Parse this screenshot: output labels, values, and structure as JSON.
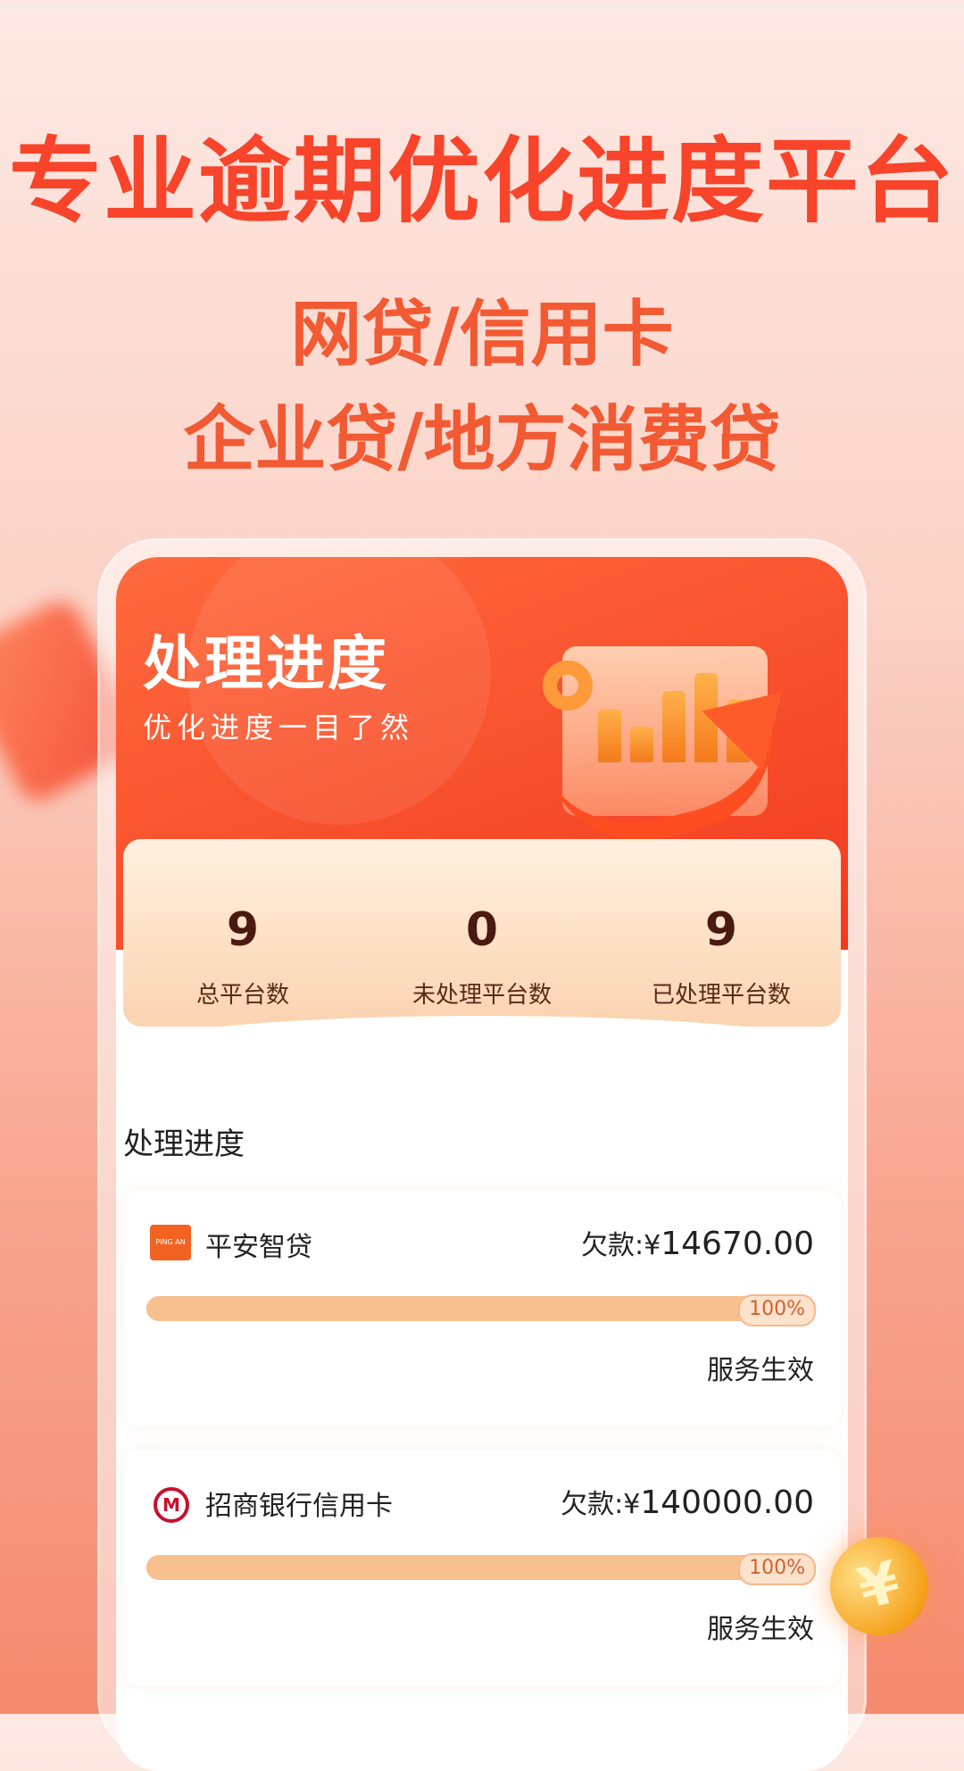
{
  "hero": {
    "title": "专业逾期优化进度平台",
    "subtitle_line1": "网贷/信用卡",
    "subtitle_line2": "企业贷/地方消费贷"
  },
  "screen": {
    "title": "处理进度",
    "subtitle": "优化进度一目了然",
    "stats": [
      {
        "value": "9",
        "label": "总平台数"
      },
      {
        "value": "0",
        "label": "未处理平台数"
      },
      {
        "value": "9",
        "label": "已处理平台数"
      }
    ],
    "section_title": "处理进度",
    "items": [
      {
        "logo": "平安logo",
        "name": "平安智贷",
        "debt_label": "欠款:",
        "currency": "¥",
        "amount": "14670.00",
        "progress": 1.0,
        "progress_text": "100%",
        "status": "服务生效"
      },
      {
        "logo": "招商银行logo",
        "name": "招商银行信用卡",
        "debt_label": "欠款:",
        "currency": "¥",
        "amount": "140000.00",
        "progress": 1.0,
        "progress_text": "100%",
        "status": "服务生效"
      }
    ]
  },
  "colors": {
    "primary": "#f7442a",
    "header_gradient_start": "#ff6a3d",
    "header_gradient_end": "#f23a1f",
    "progress": "#f7c08e"
  },
  "icons": {
    "pingan": "pingan-logo-icon",
    "cmb": "cmb-logo-icon",
    "coin": "yuan-coin-icon"
  }
}
